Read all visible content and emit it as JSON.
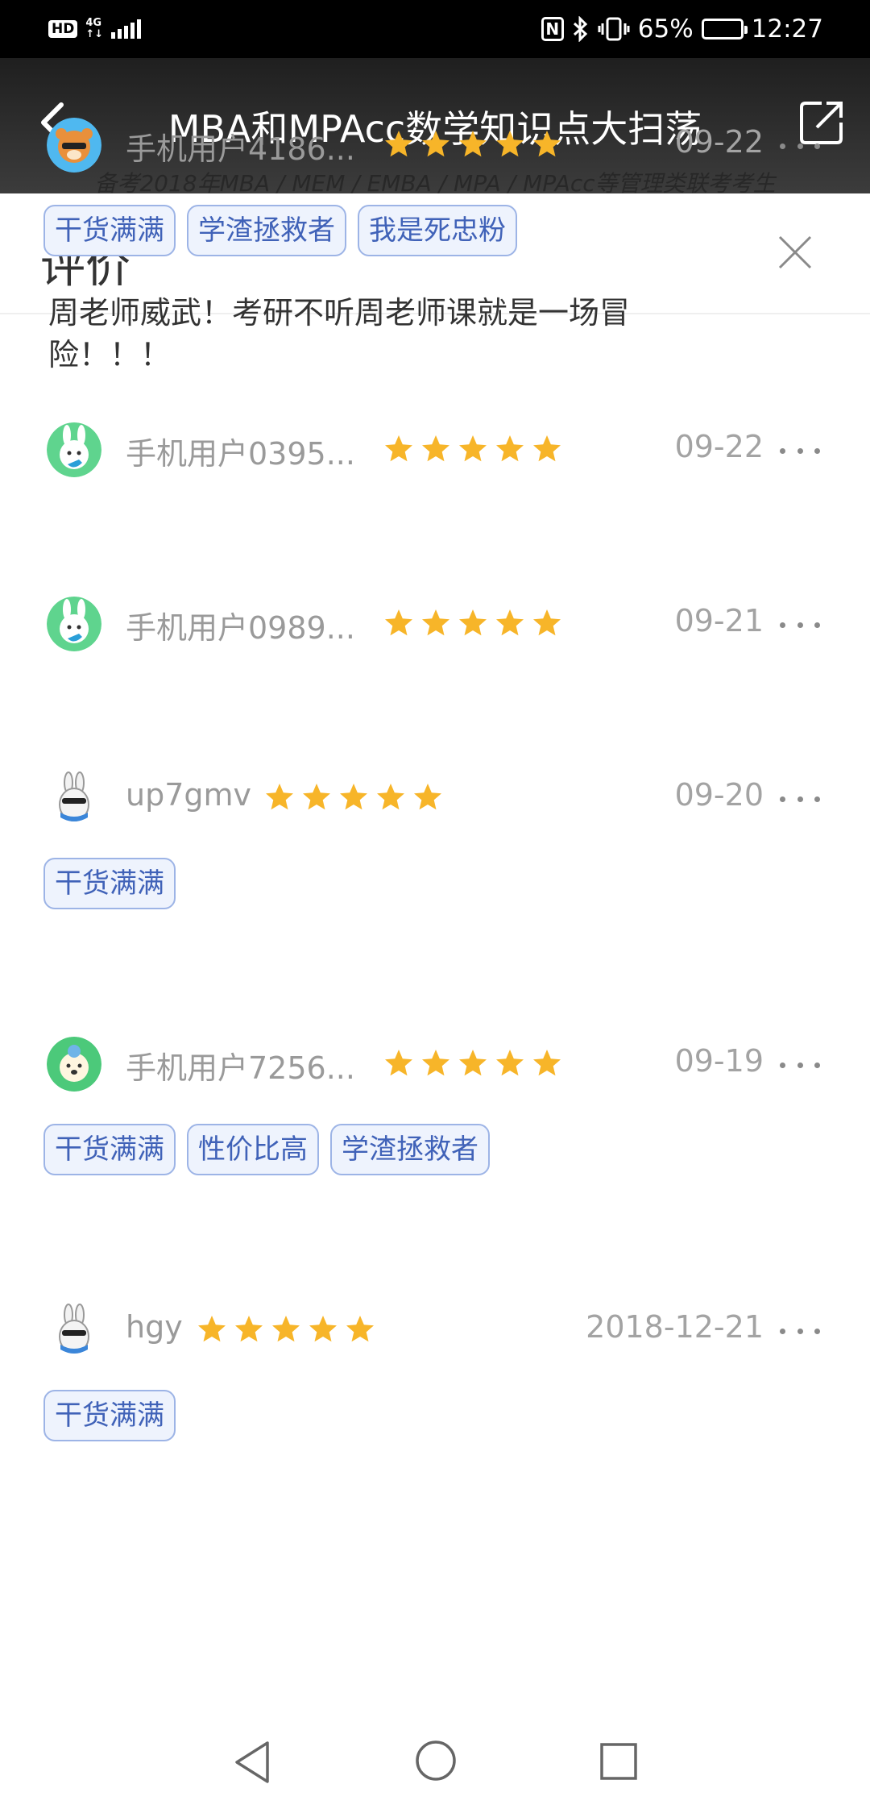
{
  "status_bar": {
    "hd": "HD",
    "network": "4G",
    "battery": "65%",
    "battery_level": 0.65,
    "time": "12:27"
  },
  "header": {
    "title": "MBA和MPAcc数学知识点大扫荡",
    "subtitle": "备考2018年MBA / MEM / EMBA / MPA / MPAcc等管理类联考考生"
  },
  "sheet": {
    "title": "评价"
  },
  "colors": {
    "star": "#f7b529",
    "tag_border": "#9db4e6",
    "tag_bg": "#eef3fd",
    "tag_text": "#4062b8"
  },
  "reviews": [
    {
      "username": "手机用户4186...",
      "rating": 5,
      "date": "09-22",
      "avatar": "tiger-avatar",
      "tags": [
        "干货满满",
        "学渣拯救者",
        "我是死忠粉"
      ],
      "text": "周老师威武！考研不听周老师课就是一场冒险！！！"
    },
    {
      "username": "手机用户0395...",
      "rating": 5,
      "date": "09-22",
      "avatar": "bunny-green-avatar",
      "tags": [],
      "text": ""
    },
    {
      "username": "手机用户0989...",
      "rating": 5,
      "date": "09-21",
      "avatar": "bunny-green-avatar",
      "tags": [],
      "text": ""
    },
    {
      "username": "up7gmv",
      "rating": 5,
      "date": "09-20",
      "avatar": "bunny-sunglasses-avatar",
      "tags": [
        "干货满满"
      ],
      "text": ""
    },
    {
      "username": "手机用户7256...",
      "rating": 5,
      "date": "09-19",
      "avatar": "cat-green-avatar",
      "tags": [
        "干货满满",
        "性价比高",
        "学渣拯救者"
      ],
      "text": ""
    },
    {
      "username": "hgy",
      "rating": 5,
      "date": "2018-12-21",
      "avatar": "bunny-sunglasses-avatar",
      "tags": [
        "干货满满"
      ],
      "text": ""
    }
  ]
}
